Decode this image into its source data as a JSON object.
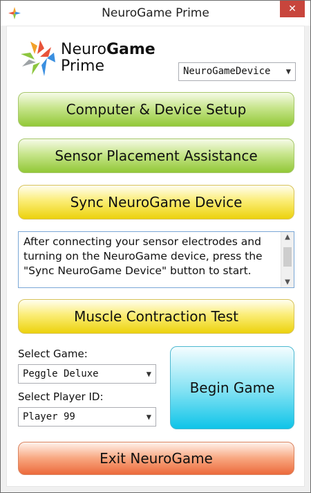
{
  "window": {
    "title": "NeuroGame Prime",
    "close_label": "✕"
  },
  "logo": {
    "line1_light": "Neuro",
    "line1_bold": "Game",
    "line2": "Prime"
  },
  "device_select": {
    "value": "NeuroGameDevice"
  },
  "buttons": {
    "setup": "Computer & Device Setup",
    "sensor": "Sensor Placement Assistance",
    "sync": "Sync NeuroGame Device",
    "muscle": "Muscle Contraction Test",
    "begin": "Begin Game",
    "exit": "Exit NeuroGame"
  },
  "instructions": {
    "text": "After connecting your sensor electrodes and turning on the NeuroGame device, press the \"Sync NeuroGame Device\" button to start."
  },
  "game": {
    "label": "Select Game:",
    "value": "Peggle Deluxe"
  },
  "player": {
    "label": "Select Player ID:",
    "value": "Player 99"
  },
  "colors": {
    "green": "#92c837",
    "yellow": "#ecd20d",
    "cyan": "#0fc4e8",
    "red": "#ec6a3c",
    "close": "#c8453c"
  },
  "icons": [
    "app-icon",
    "logo-icon",
    "chevron-down-icon",
    "close-icon"
  ]
}
